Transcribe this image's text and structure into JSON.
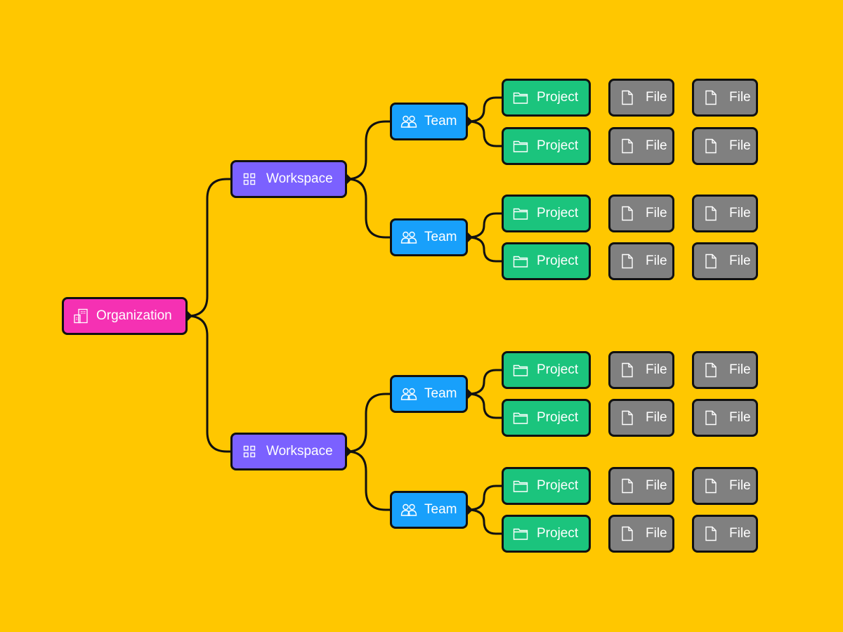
{
  "diagram": {
    "title": "",
    "colors": {
      "background": "#FFC700",
      "organization": "#F531B3",
      "workspace": "#7B61FF",
      "team": "#18A0FB",
      "project": "#1BC47D",
      "file": "#808080",
      "connector": "#111111"
    },
    "organization": {
      "label": "Organization",
      "icon": "building-icon",
      "workspaces": [
        {
          "label": "Workspace",
          "icon": "grid-icon",
          "teams": [
            {
              "label": "Team",
              "icon": "users-icon",
              "projects": [
                {
                  "label": "Project",
                  "icon": "folder-icon",
                  "files": [
                    "File",
                    "File"
                  ]
                },
                {
                  "label": "Project",
                  "icon": "folder-icon",
                  "files": [
                    "File",
                    "File"
                  ]
                }
              ]
            },
            {
              "label": "Team",
              "icon": "users-icon",
              "projects": [
                {
                  "label": "Project",
                  "icon": "folder-icon",
                  "files": [
                    "File",
                    "File"
                  ]
                },
                {
                  "label": "Project",
                  "icon": "folder-icon",
                  "files": [
                    "File",
                    "File"
                  ]
                }
              ]
            }
          ]
        },
        {
          "label": "Workspace",
          "icon": "grid-icon",
          "teams": [
            {
              "label": "Team",
              "icon": "users-icon",
              "projects": [
                {
                  "label": "Project",
                  "icon": "folder-icon",
                  "files": [
                    "File",
                    "File"
                  ]
                },
                {
                  "label": "Project",
                  "icon": "folder-icon",
                  "files": [
                    "File",
                    "File"
                  ]
                }
              ]
            },
            {
              "label": "Team",
              "icon": "users-icon",
              "projects": [
                {
                  "label": "Project",
                  "icon": "folder-icon",
                  "files": [
                    "File",
                    "File"
                  ]
                },
                {
                  "label": "Project",
                  "icon": "folder-icon",
                  "files": [
                    "File",
                    "File"
                  ]
                }
              ]
            }
          ]
        }
      ]
    }
  }
}
